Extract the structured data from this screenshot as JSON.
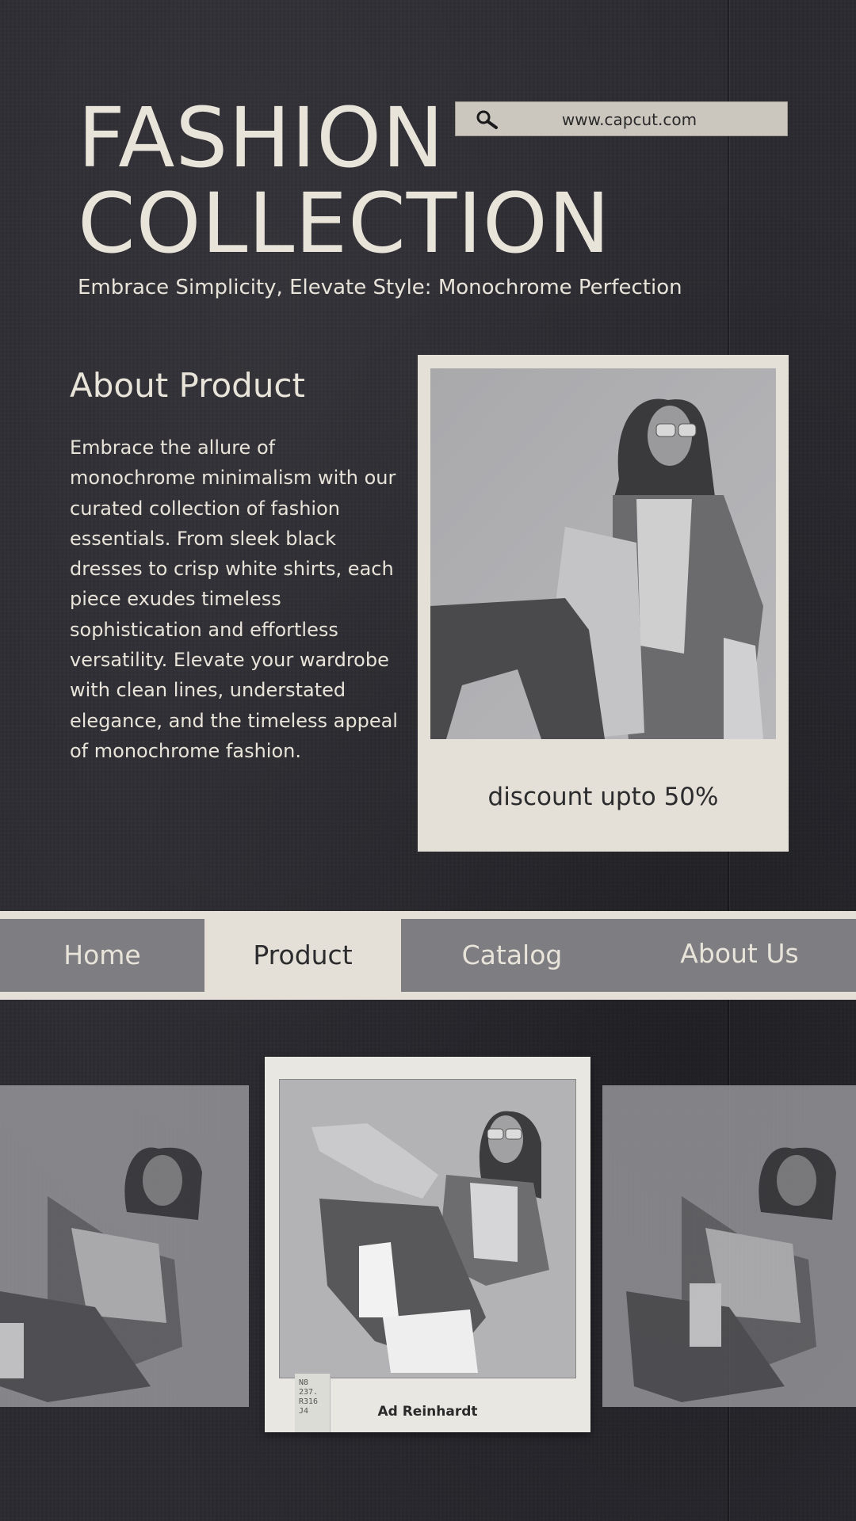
{
  "header": {
    "title_line1": "FASHION",
    "title_line2": "COLLECTION",
    "tagline": "Embrace Simplicity, Elevate Style: Monochrome Perfection"
  },
  "search": {
    "url": "www.capcut.com",
    "icon": "search-icon"
  },
  "about": {
    "title": "About Product",
    "body": "Embrace the allure of monochrome minimalism with our curated collection of  fashion essentials. From sleek black dresses to crisp white shirts, each piece exudes timeless sophistication and effortless versatility. Elevate your wardrobe with clean lines, understated elegance, and the timeless appeal of monochrome fashion."
  },
  "product_card": {
    "discount": "discount upto 50%"
  },
  "nav": {
    "items": [
      {
        "label": "Home",
        "active": false
      },
      {
        "label": "Product",
        "active": true
      },
      {
        "label": "Catalog",
        "active": false
      },
      {
        "label": "About Us",
        "active": false
      }
    ]
  },
  "gallery": {
    "caption": "Ad Reinhardt",
    "call_number": "N8\n237.\nR316\nJ4"
  },
  "colors": {
    "background": "#2b2b31",
    "cream": "#e4e0d7",
    "text_light": "#e9e4da",
    "nav_gray": "#7d7d82",
    "dark_text": "#2c2c2e"
  }
}
